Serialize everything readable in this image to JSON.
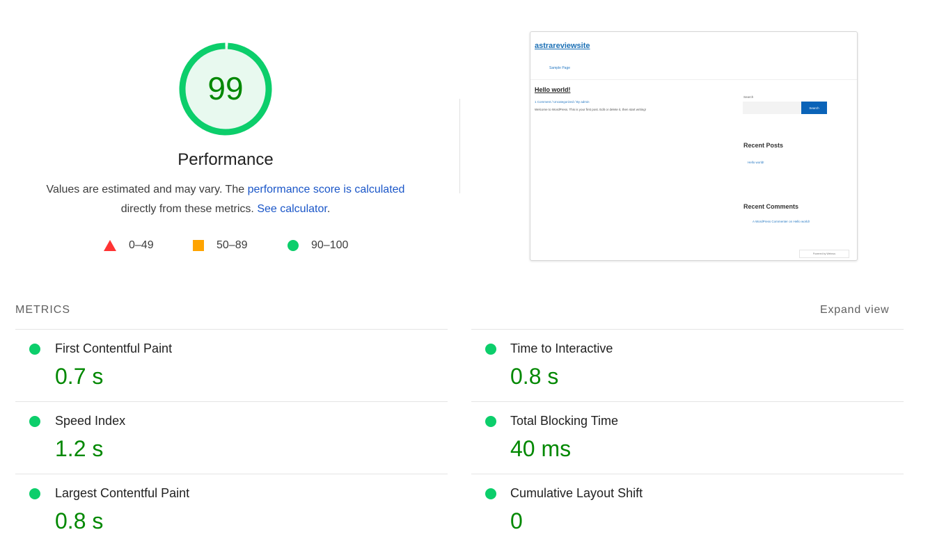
{
  "summary": {
    "score": "99",
    "score_fraction": 0.99,
    "title": "Performance",
    "description_prefix": "Values are estimated and may vary. The ",
    "description_link1": "performance score is calculated",
    "description_middle": "directly from these metrics. ",
    "description_link2": "See calculator",
    "description_suffix": ".",
    "legend": [
      {
        "range": "0–49",
        "shape": "triangle-icon",
        "color": "#ff3333"
      },
      {
        "range": "50–89",
        "shape": "square-icon",
        "color": "#ffa400"
      },
      {
        "range": "90–100",
        "shape": "circle-icon",
        "color": "#0cce6b"
      }
    ],
    "gauge_color": "#0cce6b",
    "score_color": "#008800"
  },
  "thumbnail": {
    "site_title": "astrareviewsite",
    "nav_link": "Sample Page",
    "post_title": "Hello world!",
    "post_meta": "1 Comment / Uncategorized / By admin",
    "post_excerpt": "Welcome to WordPress. This is your first post. Edit or delete it, then start writing!",
    "search_label": "Search",
    "search_button": "Search",
    "recent_posts_heading": "Recent Posts",
    "recent_post_link": "Hello world!",
    "recent_comments_heading": "Recent Comments",
    "recent_comment_link": "A WordPress Commenter on Hello world!",
    "powered_by": "Powered by Webnus"
  },
  "metrics": {
    "title": "METRICS",
    "expand_label": "Expand view",
    "items": [
      {
        "label": "First Contentful Paint",
        "value": "0.7 s"
      },
      {
        "label": "Time to Interactive",
        "value": "0.8 s"
      },
      {
        "label": "Speed Index",
        "value": "1.2 s"
      },
      {
        "label": "Total Blocking Time",
        "value": "40 ms"
      },
      {
        "label": "Largest Contentful Paint",
        "value": "0.8 s"
      },
      {
        "label": "Cumulative Layout Shift",
        "value": "0"
      }
    ]
  }
}
